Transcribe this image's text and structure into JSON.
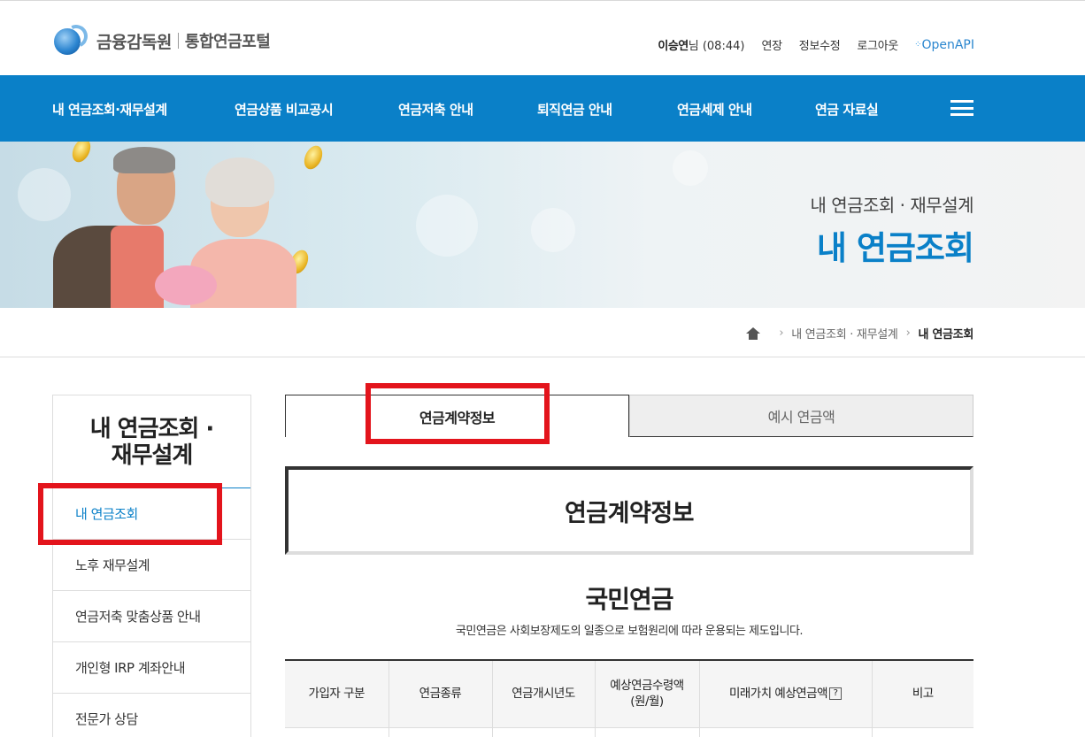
{
  "header": {
    "logo_name": "금융감독원",
    "logo_sub": "통합연금포털",
    "user_name": "이승연",
    "user_suffix": "님 (08:44)",
    "util_links": [
      "연장",
      "정보수정",
      "로그아웃"
    ],
    "openapi_label": "OpenAPI"
  },
  "gnb": {
    "items": [
      "내 연금조회·재무설계",
      "연금상품 비교공시",
      "연금저축 안내",
      "퇴직연금 안내",
      "연금세제 안내",
      "연금 자료실"
    ]
  },
  "visual": {
    "subtitle": "내 연금조회 · 재무설계",
    "title": "내 연금조회"
  },
  "breadcrumb": {
    "level1": "내 연금조회 · 재무설계",
    "current": "내 연금조회"
  },
  "lnb": {
    "title_line1": "내 연금조회 ·",
    "title_line2": "재무설계",
    "items": [
      "내 연금조회",
      "노후 재무설계",
      "연금저축 맞춤상품 안내",
      "개인형 IRP 계좌안내",
      "전문가 상담"
    ]
  },
  "tabs": {
    "active": "연금계약정보",
    "inactive": "예시 연금액"
  },
  "section": {
    "box_title": "연금계약정보",
    "heading": "국민연금",
    "description": "국민연금은 사회보장제도의 일종으로 보험원리에 따라 운용되는 제도입니다."
  },
  "table": {
    "headers": [
      "가입자 구분",
      "연금종류",
      "연금개시년도",
      "예상연금수령액",
      "(원/월)",
      "미래가치 예상연금액",
      "비고"
    ],
    "help_mark": "?"
  },
  "colors": {
    "brand_blue": "#0a80c8",
    "highlight_red": "#e3141c"
  }
}
